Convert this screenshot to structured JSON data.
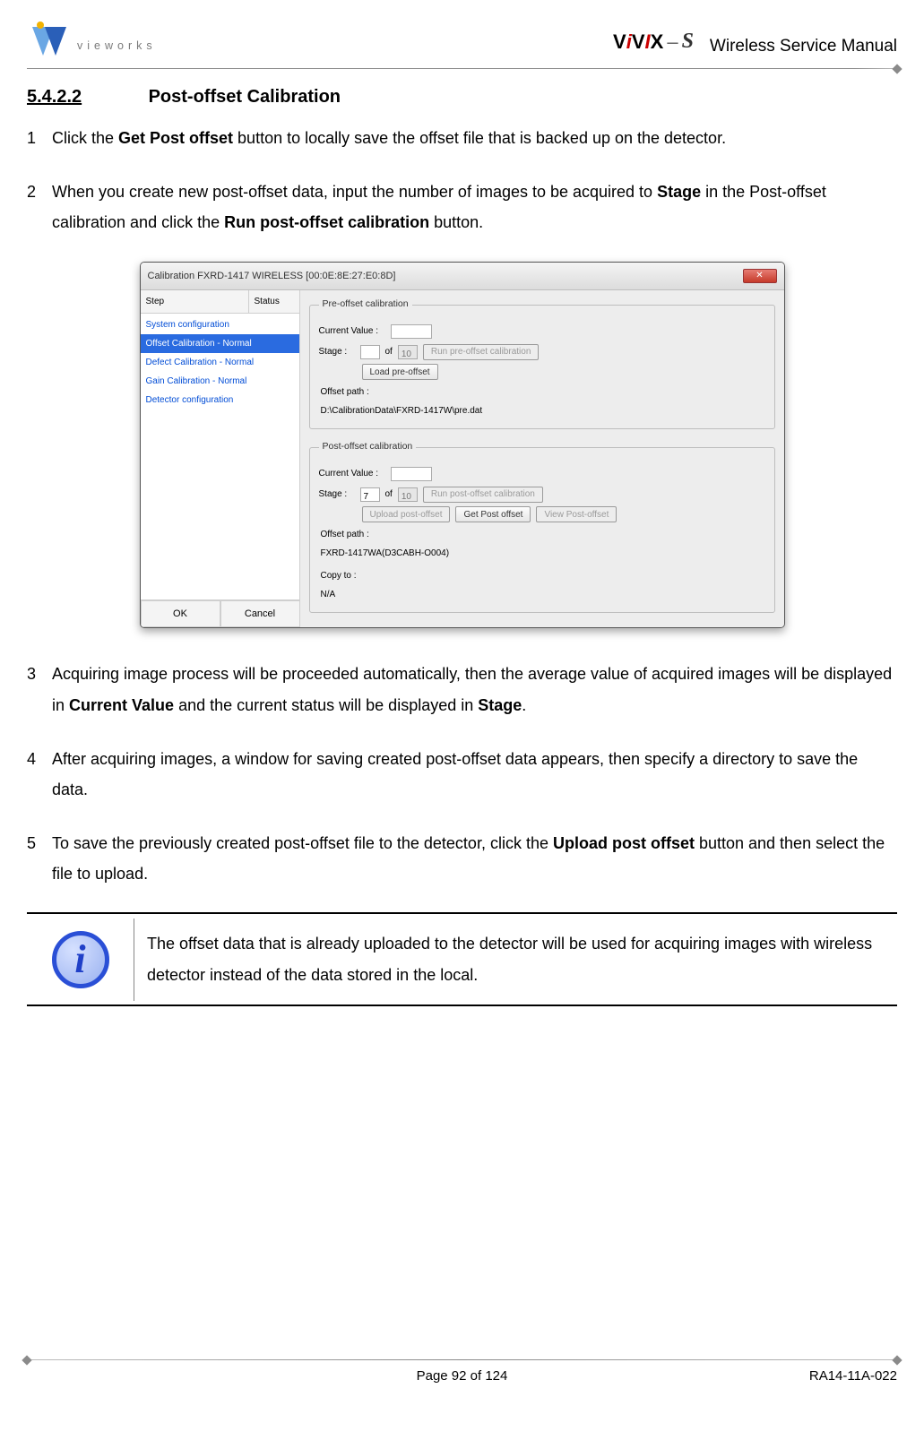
{
  "header": {
    "logo_text": "vieworks",
    "product_logo": {
      "part1": "V",
      "part2": "i",
      "part3": "V",
      "part4": "I",
      "part5": "X",
      "dash": "–",
      "suffix": "S"
    },
    "doc_title": "Wireless Service Manual"
  },
  "section": {
    "number": "5.4.2.2",
    "title": "Post-offset Calibration"
  },
  "steps": [
    {
      "n": "1",
      "pre": "Click the ",
      "b1": "Get Post offset",
      "mid": " button to locally save the offset file that is backed up on the detector."
    },
    {
      "n": "2",
      "pre": "When you create new post-offset data, input the number of images to be acquired to ",
      "b1": "Stage",
      "mid": " in the Post-offset calibration and click the ",
      "b2": "Run post-offset calibration",
      "post": " button."
    },
    {
      "n": "3",
      "pre": "Acquiring image process will be proceeded automatically, then the average value of acquired images will be displayed in ",
      "b1": "Current Value",
      "mid": " and the current status will be displayed in ",
      "b2": "Stage",
      "post": "."
    },
    {
      "n": "4",
      "pre": "After acquiring images, a window for saving created post-offset data appears, then specify a directory to save the data."
    },
    {
      "n": "5",
      "pre": "To save the previously created post-offset file to the detector, click the ",
      "b1": "Upload post offset",
      "mid": " button and then select the file to upload."
    }
  ],
  "dialog": {
    "title": "Calibration   FXRD-1417 WIRELESS  [00:0E:8E:27:E0:8D]",
    "close": "✕",
    "columns": {
      "c1": "Step",
      "c2": "Status"
    },
    "steps": [
      "System configuration",
      "Offset Calibration - Normal",
      "Defect Calibration - Normal",
      "Gain Calibration - Normal",
      "Detector configuration"
    ],
    "selected_index": 1,
    "pre": {
      "legend": "Pre-offset calibration",
      "current_label": "Current Value :",
      "stage_label": "Stage :",
      "of_label": "of",
      "total": "10",
      "run_btn": "Run pre-offset calibration",
      "load_btn": "Load pre-offset",
      "path_label": "Offset path :",
      "path_value": "D:\\CalibrationData\\FXRD-1417W\\pre.dat"
    },
    "post": {
      "legend": "Post-offset calibration",
      "current_label": "Current Value :",
      "stage_label": "Stage :",
      "of_label": "of",
      "stage_val": "7",
      "total": "10",
      "run_btn": "Run post-offset calibration",
      "upload_btn": "Upload post-offset",
      "get_btn": "Get Post offset",
      "view_btn": "View Post-offset",
      "path_label": "Offset path :",
      "path_value": "FXRD-1417WA(D3CABH-O004)",
      "copy_label": "Copy to :",
      "copy_value": "N/A"
    },
    "ok": "OK",
    "cancel": "Cancel"
  },
  "info_note": "The offset data that is already uploaded to the detector will be used for acquiring images with wireless detector instead of the data stored in the local.",
  "footer": {
    "page": "Page 92 of 124",
    "code": "RA14-11A-022"
  }
}
